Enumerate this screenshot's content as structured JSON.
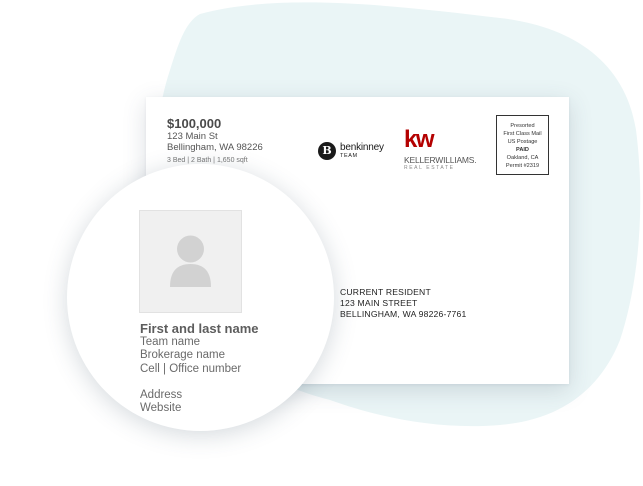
{
  "colors": {
    "background_blob": "#eaf5f6",
    "kw_red": "#b40101",
    "text_dark": "#4a4a4a"
  },
  "listing": {
    "price": "$100,000",
    "street": "123 Main St",
    "city": "Bellingham, WA 98226",
    "details": "3 Bed | 2 Bath | 1,650 sqft"
  },
  "team_logo": {
    "letter": "B",
    "name": "benkinney",
    "subtitle": "TEAM"
  },
  "brokerage_logo": {
    "mark": "kw",
    "name": "KELLERWILLIAMS.",
    "subtitle": "REAL ESTATE"
  },
  "postage": {
    "lines": [
      "Presorted",
      "First Class Mail",
      "US Postage"
    ],
    "paid": "PAID",
    "location": "Oakland, CA",
    "permit": "Permit #2319"
  },
  "recipient": {
    "line1": "CURRENT RESIDENT",
    "line2": "123 MAIN STREET",
    "line3": "BELLINGHAM, WA 98226-7761"
  },
  "agent": {
    "photo_icon": "person-silhouette-icon",
    "name": "First and last name",
    "team": "Team name",
    "brokerage": "Brokerage name",
    "phone": "Cell | Office number",
    "address": "Address",
    "website": "Website"
  }
}
